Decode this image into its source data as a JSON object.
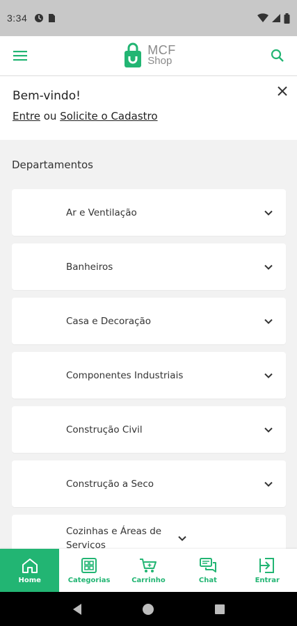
{
  "status_bar": {
    "time": "3:34"
  },
  "header": {
    "logo_line1": "MCF",
    "logo_line2": "Shop",
    "brand_color": "#22b573"
  },
  "welcome": {
    "title": "Bem-vindo!",
    "login_link": "Entre",
    "or_text": "ou",
    "register_link": "Solicite o Cadastro"
  },
  "departments": {
    "title": "Departamentos",
    "items": [
      {
        "label": "Ar e Ventilação"
      },
      {
        "label": "Banheiros"
      },
      {
        "label": "Casa e Decoração"
      },
      {
        "label": "Componentes Industriais"
      },
      {
        "label": "Construção Civil"
      },
      {
        "label": "Construção a Seco"
      },
      {
        "label": "Cozinhas e Áreas de Serviços"
      }
    ]
  },
  "bottom_nav": {
    "items": [
      {
        "label": "Home",
        "icon": "home-icon",
        "active": true
      },
      {
        "label": "Categorias",
        "icon": "grid-icon",
        "active": false
      },
      {
        "label": "Carrinho",
        "icon": "cart-icon",
        "active": false
      },
      {
        "label": "Chat",
        "icon": "chat-icon",
        "active": false
      },
      {
        "label": "Entrar",
        "icon": "login-icon",
        "active": false
      }
    ]
  }
}
